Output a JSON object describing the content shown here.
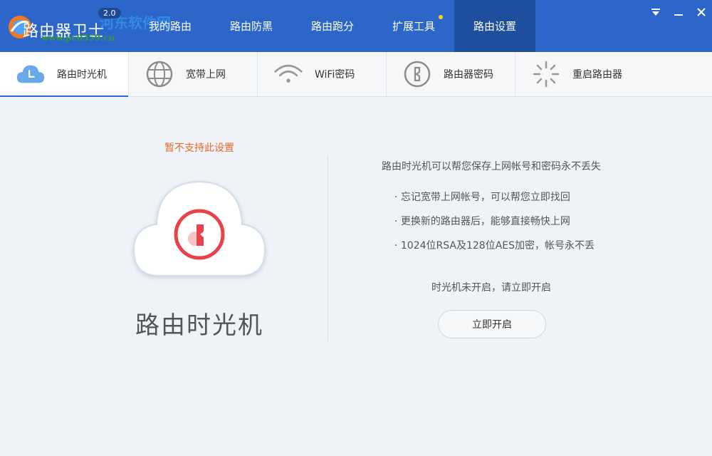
{
  "app": {
    "title": "路由器卫士",
    "version": "2.0",
    "watermark": "www.pc0359.cn",
    "watermark_overlay": "河东软件网"
  },
  "nav": {
    "items": [
      {
        "label": "我的路由"
      },
      {
        "label": "路由防黑"
      },
      {
        "label": "路由跑分"
      },
      {
        "label": "扩展工具",
        "badge_dot": true
      },
      {
        "label": "路由设置",
        "active": true
      }
    ]
  },
  "window": {
    "menu_icon": "dropdown-icon",
    "minimize_icon": "minimize-icon",
    "close_icon": "close-icon"
  },
  "tabs": [
    {
      "label": "路由时光机",
      "icon": "clock-cloud-icon",
      "active": true
    },
    {
      "label": "宽带上网",
      "icon": "globe-icon"
    },
    {
      "label": "WiFi密码",
      "icon": "wifi-icon"
    },
    {
      "label": "路由器密码",
      "icon": "key-icon"
    },
    {
      "label": "重启路由器",
      "icon": "spinner-icon"
    }
  ],
  "left": {
    "notice": "暂不支持此设置",
    "title": "路由时光机"
  },
  "right": {
    "description": "路由时光机可以帮您保存上网帐号和密码永不丢失",
    "features": [
      "· 忘记宽带上网帐号，可以帮您立即找回",
      "· 更换新的路由器后，能够直接畅快上网",
      "· 1024位RSA及128位AES加密，帐号永不丢"
    ],
    "status": "时光机未开启，请立即开启",
    "button_label": "立即开启"
  },
  "colors": {
    "header_bg": "#2b66c8",
    "header_active": "#1e4f9e",
    "notice": "#ea6a2a",
    "accent_red": "#e8434b",
    "tab_icon_blue": "#6aa9e9"
  }
}
